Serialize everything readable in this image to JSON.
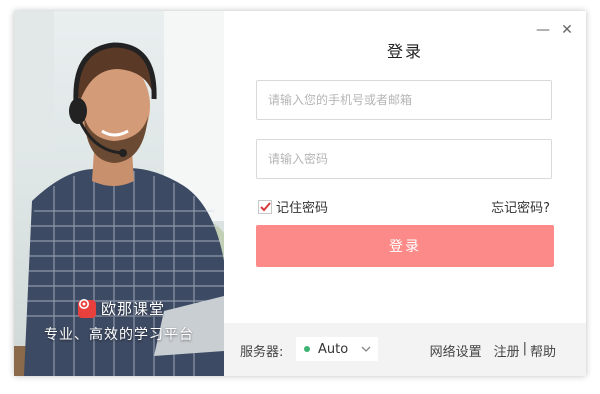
{
  "brand": {
    "name": "欧那课堂",
    "slogan": "专业、高效的学习平台",
    "accent": "#e8403d"
  },
  "window": {
    "minimize": "—",
    "close": "✕"
  },
  "login": {
    "title": "登录",
    "phone_placeholder": "请输入您的手机号或者邮箱",
    "password_placeholder": "请输入密码",
    "remember_label": "记住密码",
    "remember_checked": true,
    "forgot_label": "忘记密码?",
    "submit_label": "登录",
    "button_color": "#fb8a88"
  },
  "footer": {
    "server_label": "服务器:",
    "server_value": "Auto",
    "server_status_color": "#3cb371",
    "network_settings": "网络设置",
    "register": "注册",
    "separator": "|",
    "help": "帮助"
  }
}
